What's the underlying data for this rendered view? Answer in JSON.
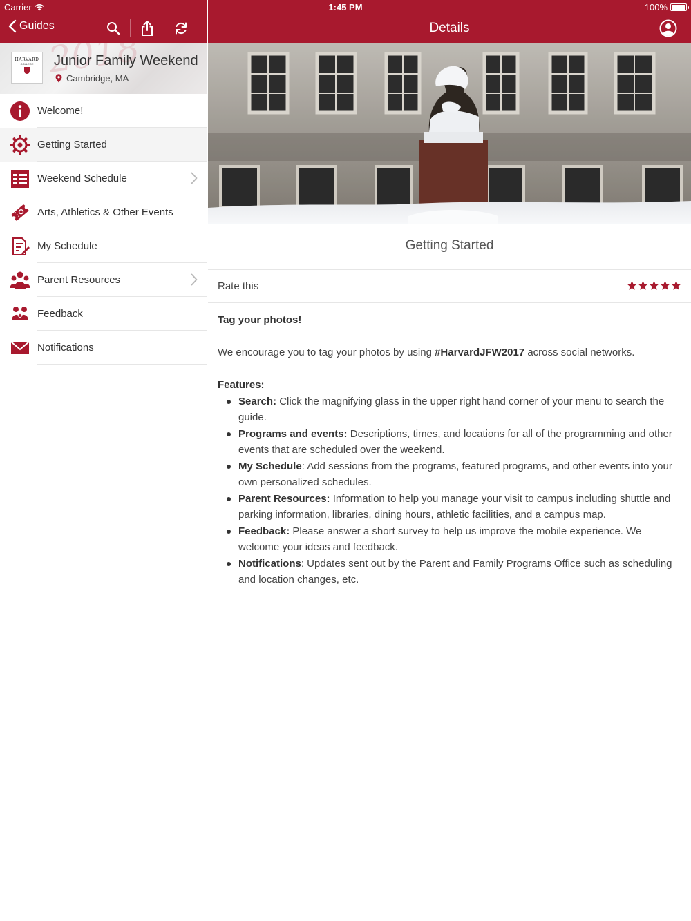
{
  "status_bar": {
    "carrier": "Carrier",
    "time": "1:45 PM",
    "battery": "100%"
  },
  "left_nav": {
    "back_label": "Guides"
  },
  "guide": {
    "banner_text": "2018",
    "title": "Junior Family Weekend",
    "location": "Cambridge, MA",
    "logo_text": "HARVARD",
    "logo_subtext": "COLLEGE"
  },
  "menu": [
    {
      "label": "Welcome!",
      "icon": "info-icon",
      "active": false,
      "chevron": false
    },
    {
      "label": "Getting Started",
      "icon": "gear-icon",
      "active": true,
      "chevron": false
    },
    {
      "label": "Weekend Schedule",
      "icon": "schedule-icon",
      "active": false,
      "chevron": true
    },
    {
      "label": "Arts, Athletics & Other Events",
      "icon": "ticket-icon",
      "active": false,
      "chevron": false
    },
    {
      "label": "My Schedule",
      "icon": "edit-schedule-icon",
      "active": false,
      "chevron": false
    },
    {
      "label": "Parent Resources",
      "icon": "people-icon",
      "active": false,
      "chevron": true
    },
    {
      "label": "Feedback",
      "icon": "feedback-icon",
      "active": false,
      "chevron": false
    },
    {
      "label": "Notifications",
      "icon": "envelope-icon",
      "active": false,
      "chevron": false
    }
  ],
  "right_nav": {
    "title": "Details"
  },
  "detail": {
    "title": "Getting Started",
    "rate_label": "Rate this",
    "rating": 5,
    "tag_heading": "Tag your photos!",
    "encourage_pre": "We encourage you to tag your photos by using ",
    "hashtag": "#HarvardJFW2017",
    "encourage_post": " across social networks.",
    "features_heading": "Features:",
    "features": [
      {
        "term": "Search:",
        "text": " Click the magnifying glass in the upper right hand corner of your menu to search the guide."
      },
      {
        "term": "Programs and events:",
        "text": " Descriptions, times, and locations for all of the programming and other events that are scheduled over the weekend."
      },
      {
        "term": "My Schedule",
        "text": ": Add sessions from the programs, featured programs, and other events into your own personalized schedules."
      },
      {
        "term": "Parent Resources:",
        "text": " Information to help you manage your visit to campus including shuttle and parking information, libraries, dining hours, athletic facilities, and a campus map."
      },
      {
        "term": "Feedback:",
        "text": " Please answer a short survey to help us improve the mobile experience. We welcome your ideas and feedback."
      },
      {
        "term": "Notifications",
        "text": ": Updates sent out by the Parent and Family Programs Office such as scheduling and location changes, etc."
      }
    ]
  },
  "colors": {
    "brand": "#a8192e",
    "text": "#333333",
    "separator": "#e6e6e6"
  }
}
